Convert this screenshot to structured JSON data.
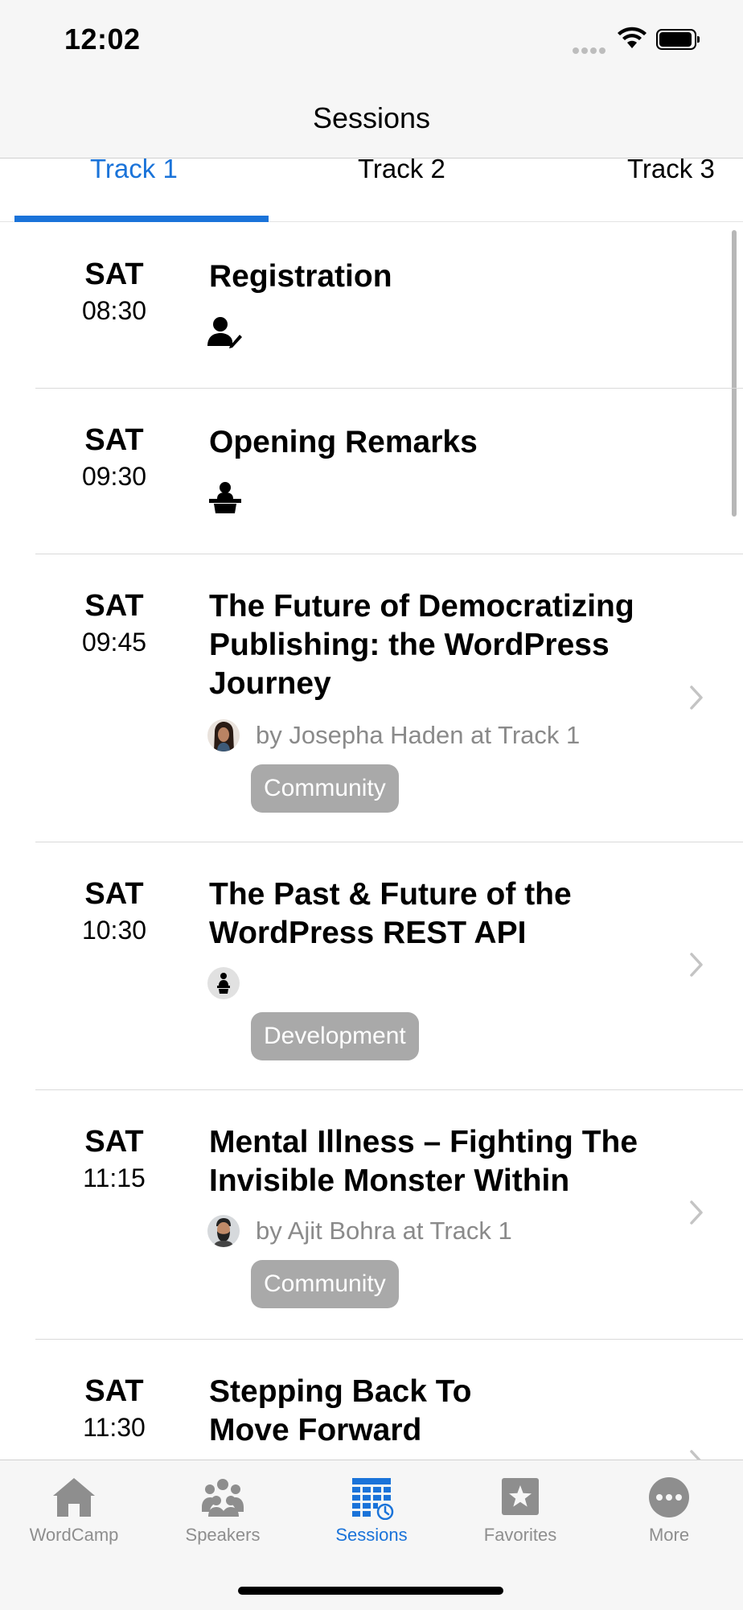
{
  "status_bar": {
    "time": "12:02"
  },
  "nav": {
    "title": "Sessions"
  },
  "tabs": [
    {
      "label": "Track 1",
      "active": true
    },
    {
      "label": "Track 2",
      "active": false
    },
    {
      "label": "Track 3",
      "active": false
    }
  ],
  "sessions": [
    {
      "day": "SAT",
      "time": "08:30",
      "title": "Registration",
      "icon": "registration-icon"
    },
    {
      "day": "SAT",
      "time": "09:30",
      "title": "Opening Remarks",
      "icon": "podium-icon"
    },
    {
      "day": "SAT",
      "time": "09:45",
      "title_lines": [
        "The Future of Democratizing",
        "Publishing: the WordPress",
        "Journey"
      ],
      "speaker": "by Josepha Haden at Track 1",
      "tag": "Community"
    },
    {
      "day": "SAT",
      "time": "10:30",
      "title_lines": [
        "The Past & Future of the",
        "WordPress REST API"
      ],
      "tag": "Development"
    },
    {
      "day": "SAT",
      "time": "11:15",
      "title_lines": [
        "Mental Illness – Fighting The",
        "Invisible Monster Within"
      ],
      "speaker": "by Ajit Bohra at Track 1",
      "tag": "Community"
    },
    {
      "day": "SAT",
      "time": "11:30",
      "title_lines": [
        "Stepping Back To",
        "Move Forward"
      ]
    }
  ],
  "tab_bar": {
    "items": [
      {
        "label": "WordCamp",
        "icon": "home-icon"
      },
      {
        "label": "Speakers",
        "icon": "people-icon"
      },
      {
        "label": "Sessions",
        "icon": "calendar-grid-icon",
        "active": true
      },
      {
        "label": "Favorites",
        "icon": "star-icon"
      },
      {
        "label": "More",
        "icon": "more-icon"
      }
    ]
  },
  "colors": {
    "accent": "#1a73d9",
    "tag_bg": "#a9a9a9",
    "bar_bg": "#f6f6f6"
  }
}
